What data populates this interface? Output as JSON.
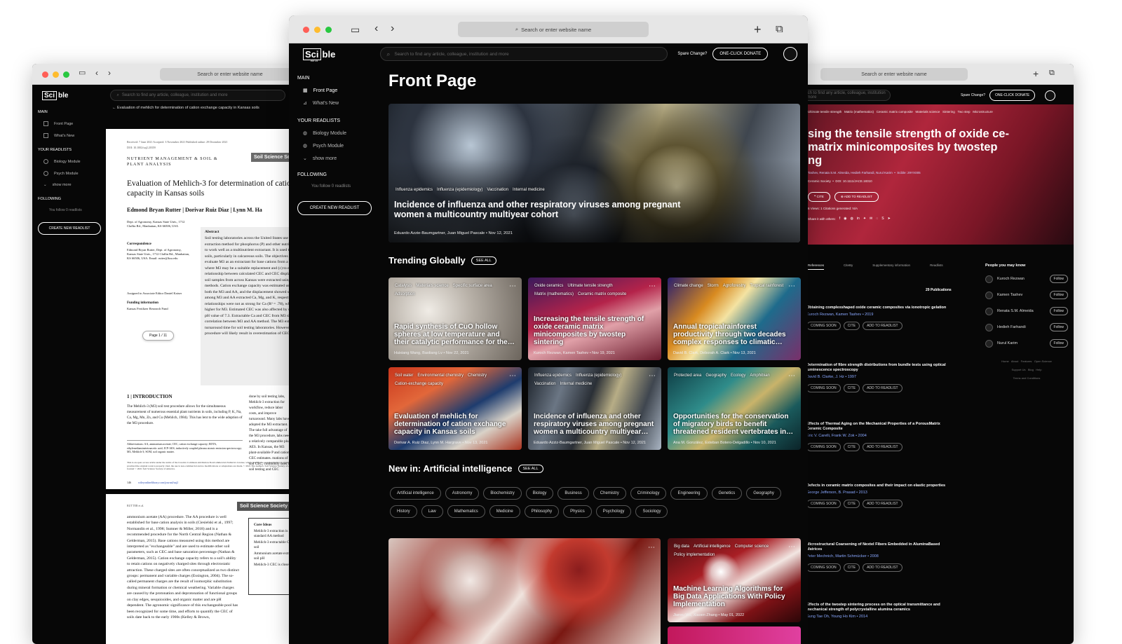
{
  "browser": {
    "url_placeholder": "Search or enter website name"
  },
  "site": {
    "logo_left": "Sci",
    "logo_right": "ble",
    "logo_beta": "BETA",
    "search_placeholder": "Search to find any article, colleague, institution and more",
    "spare_change": "Spare Change?",
    "donate": "ONE-CLICK DONATE"
  },
  "sidebar": {
    "main_label": "MAIN",
    "front_page": "Front Page",
    "whats_new": "What's New",
    "readlists_label": "YOUR READLISTS",
    "biology": "Biology Module",
    "psych": "Psych Module",
    "show_more": "show more",
    "following_label": "FOLLOWING",
    "following_text": "You follow 0 readlists",
    "create": "CREATE NEW READLIST"
  },
  "left_window": {
    "back_text": "Evaluation of mehlich for determination of cation exchange capacity in Kansas soils",
    "paper": {
      "dates": "Received: 7 June 2021    Accepted: 3 November 2021    Published online: 29 December 2021",
      "doi": "DOI: 10.1002/saj2.20359",
      "journal": "Soil Science Society",
      "section": "NUTRIENT MANAGEMENT & SOIL & PLANT ANALYSIS",
      "title": "Evaluation of Mehlich-3 for determination of cation exchange capacity in Kansas soils",
      "authors": "Edmond Bryan Rutter   |   Dorivar Ruiz Diaz   |   Lynn M. Ha",
      "abstract_head": "Abstract",
      "abstract": "Soil testing laboratories across the United States use the Mehlich-3 (M3) extraction method for phosphorus (P) and other nutrients. M3 is considered to work well as a multinutrient extractant. It is used to extract cations from soils, particularly in calcareous soils. The objectives of this study were to evaluate M3 as an extractant for base cations from a wide range of soil pH where M3 may be a suitable replacement and (c) to examine the relationship between calculated CEC and CEC displacement. A total of 100 soil samples from across Kansas were extracted using both the M3 and AA methods. Cation exchange capacity was estimated using measurements of both the M3 and AA, and the displacement showed strong correlation among M3 and AA extracted Ca, Mg, and K, respectively. However, these relationships were not as strong for Ca (R² = .78), where extractable Ca was higher for M3. Estimated CEC was also affected by soil pH where a critical pH value of 7.3. Extractable Ca and CEC from M3 showed a strong correlation between M3 and AA method. The M3 extractant can improve turnaround time for soil testing laboratories. However, the use of the M3 procedure will likely result in overestimation of CEC.",
      "affil": "Dept. of Agronomy, Kansas State Univ., 1712 Claflin Rd., Manhattan, KS 66506, USA",
      "corr_head": "Correspondence",
      "corr": "Edmond Bryan Rutter, Dept. of Agronomy, Kansas State Univ., 1712 Claflin Rd., Manhattan, KS 66506, USA. Email: rutter@ksu.edu",
      "editor": "Assigned to Associate Editor Daniel Kaiser",
      "fund_head": "Funding information",
      "fund": "Kansas Fertilizer Research Fund",
      "page": "Page 1 / 11",
      "intro_num": "1   |",
      "intro_head": "INTRODUCTION",
      "intro": "The Mehlich-3 (M3) soil test procedure allows for the simultaneous measurement of numerous essential plant nutrients in soils, including P, K, Na, Ca, Mg, Mn, Zn, and Cu (Mehlich, 1984). This has lent to the wide adoption of the M3 procedure.",
      "abbr": "Abbreviations: AA, ammonium acetate; CEC, cation exchange capacity; EDTA, ethylenediaminetetraacetic acid; ICP-AES, inductively coupled plasma atomic emission spectroscopy; M3, Mehlich-3; SOM, soil organic matter.",
      "license": "This is an open access article under the terms of the Creative Commons Attribution-NonCommercial-NoDerivs License, which permits use and distribution in any medium, provided the original work is properly cited, the use is non-commercial and no modifications or adaptations are made. © 2021 The Authors. Soil Science Society of America Journal © 2021 Soil Science Society of America.",
      "footer_page": "146",
      "footer_url": "wileyonlinelibrary.com/journal/saj2",
      "page2_head": "RUTTER et al.",
      "page2_text": "ammonium acetate (AA) procedure. The AA procedure is well established for base cation analysis in soils (Ciesielski et al., 1997; Normandin et al., 1998; Sumner & Miller, 2018) and is a recommended procedure for the North Central Region (Nathan & Gelderman, 2015). Base cations measured using this method are interpreted as \"exchangeable\" and are used to estimate other soil parameters, such as CEC and base saturation percentage (Nathan & Gelderman, 2015). Cation exchange capacity refers to a soil's ability to retain cations on negatively charged sites through electrostatic attraction. These charged sites are often conceptualized as two distinct groups: permanent and variable charges (Essington, 2004). The so-called permanent charges are the result of isomorphic substitution during mineral formation or chemical weathering. Variable charges are caused by the protonation and deprotonation of functional groups on clay edges, sesquioxides, and organic matter and are pH dependent. The agronomic significance of this exchangeable pool has been recognized for some time, and efforts to quantify the CEC of soils date back to the early 1900s (Kelley & Brown,",
      "core_head": "Core Ideas",
      "core": [
        "Mehlich-3 extraction is highly correlated to the standard AA method",
        "Mehlich-3 extractable Ca is greater than AA in soil",
        "Ammonium acetate extractable Ca is related with soil pH",
        "Mehlich-3 CEC is close to CEC displacement"
      ],
      "right_col": "done by soil testing labs, Mehlich-3 extraction for workflow, reduce labor costs, and improve turnaround. Many labs have adopted the M3 extractant. The take full advantage of the M3 procedure, labs need a relatively comparable plus AES. In Kansas, the M3 plant-available P and cations CEC estimates. mations of soil CEC, commonly used in soil testing and CEC estimates."
    }
  },
  "main_window": {
    "page_title": "Front Page",
    "hero": {
      "tags": [
        "Influenza epidemics",
        "Influenza (epidemiology)",
        "Vaccination",
        "Internal medicine"
      ],
      "title": "Incidence of influenza and other respiratory viruses among pregnant women a multicountry multiyear cohort",
      "authors": "Eduardo Azzie-Baumgartner, Juan Miguel Pascale • Nov 12, 2021"
    },
    "trending_title": "Trending Globally",
    "see_all": "SEE ALL",
    "cards": [
      {
        "tags": [
          "Catalysis",
          "Materials science",
          "Specific surface area",
          "Adsorption"
        ],
        "title": "Rapid synthesis of CuO hollow spheres at low temperature and their catalytic performance for the…",
        "authors": "Huixiang Wang, Baoliang Lv • Nov 22, 2021"
      },
      {
        "tags": [
          "Oxide ceramics",
          "Ultimate tensile strength",
          "Matrix (mathematics)",
          "Ceramic matrix composite"
        ],
        "title": "Increasing the tensile strength of oxide ceramic matrix minicomposites by twostep sintering",
        "authors": "Kuroch Rezwan, Kamen Tashev • Nov 19, 2021"
      },
      {
        "tags": [
          "Climate change",
          "Storm",
          "Agroforestry",
          "Tropical rainforest"
        ],
        "title": "Annual tropicalrainforest productivity through two decades complex responses to climatic…",
        "authors": "David B. Clark, Deborah A. Clark • Nov 13, 2021"
      },
      {
        "tags": [
          "Soil water",
          "Environmental chemistry",
          "Chemistry",
          "Cation-exchange capacity"
        ],
        "title": "Evaluation of mehlich for determination of cation exchange capacity in Kansas soils",
        "authors": "Dorivar A. Ruiz Diaz, Lynn M. Hargrave • Nov 13, 2021"
      },
      {
        "tags": [
          "Influenza epidemics",
          "Influenza (epidemiology)",
          "Vaccination",
          "Internal medicine"
        ],
        "title": "Incidence of influenza and other respiratory viruses among pregnant women a multicountry multiyear…",
        "authors": "Eduardo Azziz-Baumgartner, Juan Miguel Pascale • Nov 12, 2021"
      },
      {
        "tags": [
          "Protected area",
          "Geography",
          "Ecology",
          "Amphibian"
        ],
        "title": "Opportunities for the conservation of migratory birds to benefit threatened resident vertebrates in…",
        "authors": "Ana M. González, Esteban Botero-Delgadillo • Nov 10, 2021"
      }
    ],
    "ai_title": "New in: Artificial intelligence",
    "chips": [
      "Artificial intelligence",
      "Astronomy",
      "Biochemistry",
      "Biology",
      "Business",
      "Chemistry",
      "Criminology",
      "Engineering",
      "Genetics",
      "Geography",
      "History",
      "Law",
      "Mathematics",
      "Medicine",
      "Philosophy",
      "Physics",
      "Psychology",
      "Sociology"
    ],
    "ml_card": {
      "tags": [
        "Big data",
        "Artificial intelligence",
        "Computer science",
        "Policy implementation"
      ],
      "title": "Machine Learning Algorithms for Big Data Applications With Policy Implementation",
      "authors": "Jianxu Wu, Xiaoen Zhang • May 01, 2022"
    }
  },
  "right_window": {
    "top_tags": "Ultimate tensile strength   Matrix (mathematics)   Ceramic matrix composite   Materials science   Sintering   Two step   Microstructure",
    "title_l1": "sing the tensile strength of oxide ce-",
    "title_l2": "matrix minicomposites by twostep",
    "title_l3": "ng",
    "authors": "Tashev, Renata S.M. Almeida, Hedieh Farhandi, Nurul Karim  •  Scible: 29YX005",
    "doi": "Ceramic Society  •  DOI: 10.1111/JACE.18310",
    "cite": "CITE",
    "add": "ADD TO READLIST",
    "views": "6  Views: 1  Citations generated: N/A",
    "share": "Share it with others:",
    "tabs": [
      "References",
      "CiteBy",
      "Supplementary information",
      "Readlists"
    ],
    "pubs_count": "29 Publications",
    "pubs": [
      {
        "title": "Obtaining complexshaped oxide ceramic composites via ionotropic gelation",
        "authors": "Kuroch Rezwan, Kamen Tashev • 2019"
      },
      {
        "title": "Determination of fibre strength distributions from bundle tests using optical luminescence spectroscopy",
        "authors": "David B. Clarke, J. Hz • 1997"
      },
      {
        "title": "Effects of Thermal Aging on the Mechanical Properties of a PorousMatrix Ceramic Composite",
        "authors": "Eric V. Carelli, Frank W. Zok • 2004"
      },
      {
        "title": "Defects in ceramic matrix composites and their impact on elastic properties",
        "authors": "George Jefferson, B. Prasad • 2013"
      },
      {
        "title": "Microstructural Coarsening of Nextel Fibers Embedded in AluminaBased Matrices",
        "authors": "Peter Mechnich, Martin Schmücker • 2008"
      },
      {
        "title": "Effects of the twostep sintering process on the optical transmittance and mechanical strength of polycrystalline alumina ceramics",
        "authors": "Sung Tae Oh, Young Ho Kim • 2014"
      }
    ],
    "coming_soon": "COMING SOON",
    "people_title": "People you may know",
    "people": [
      "Kuroch Rezwan",
      "Kamen Tashev",
      "Renata S.M. Almeida",
      "Hedieh Farhandi",
      "Nurul Karim"
    ],
    "follow": "Follow",
    "footer1": "Home   About   Features   Open Science",
    "footer2": "Support Us   Blog   Help",
    "footer3": "Terms and Conditions"
  },
  "colors": {
    "accent": "#ffffff",
    "background": "#070707",
    "link": "#8aa8ff"
  }
}
